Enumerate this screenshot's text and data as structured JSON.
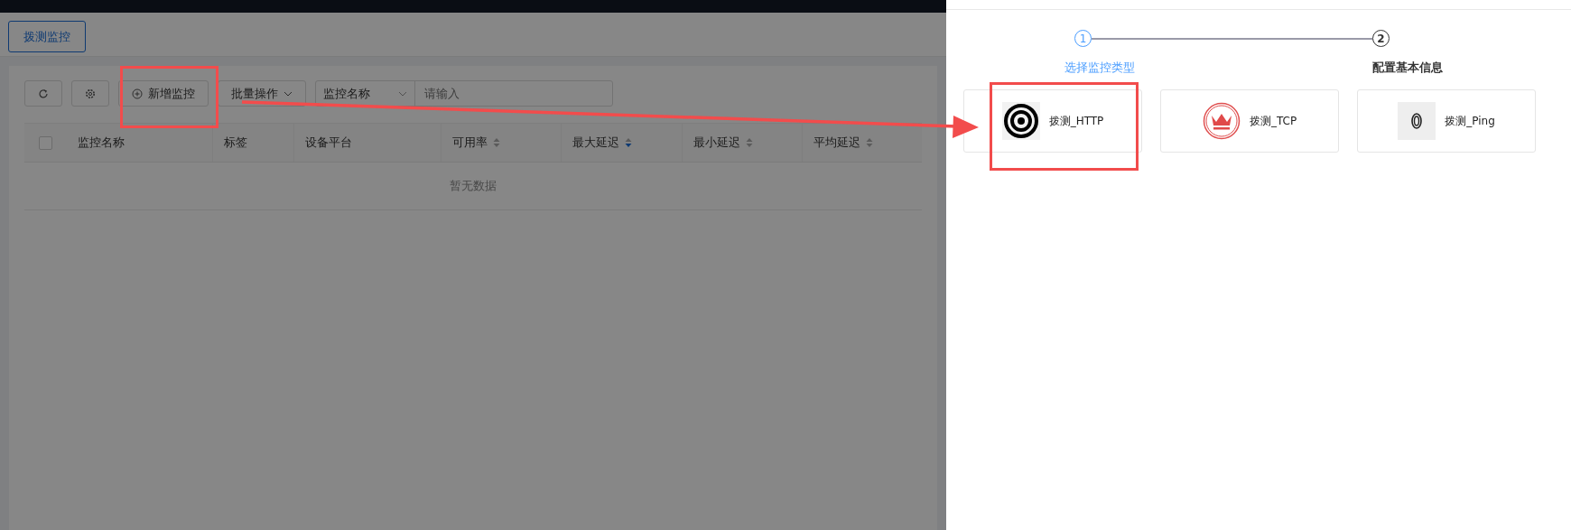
{
  "tabs": [
    {
      "label": "拨测监控",
      "selected": true
    }
  ],
  "toolbar": {
    "add_button": "新增监控",
    "batch_dropdown": "批量操作",
    "search_select": "监控名称",
    "search": {
      "placeholder": "请输入"
    }
  },
  "table": {
    "columns": [
      {
        "label": "监控名称",
        "kind": "plain"
      },
      {
        "label": "标签",
        "kind": "plain"
      },
      {
        "label": "设备平台",
        "kind": "plain"
      },
      {
        "label": "可用率",
        "kind": "sortable",
        "sorted_descending": false
      },
      {
        "label": "最大延迟",
        "kind": "sortable",
        "sorted_descending": true
      },
      {
        "label": "最小延迟",
        "kind": "sortable",
        "sorted_descending": false
      },
      {
        "label": "平均延迟",
        "kind": "sortable",
        "sorted_descending": false
      }
    ],
    "select_all_checked": false,
    "empty_text": "暂无数据"
  },
  "drawer": {
    "steps": [
      {
        "number": "1",
        "label": "选择监控类型",
        "selected": true
      },
      {
        "number": "2",
        "label": "配置基本信息",
        "selected": false
      }
    ],
    "types": [
      {
        "label": "拨测_HTTP",
        "kind": "http"
      },
      {
        "label": "拨测_TCP",
        "kind": "tcp"
      },
      {
        "label": "拨测_Ping",
        "kind": "ping"
      }
    ]
  }
}
